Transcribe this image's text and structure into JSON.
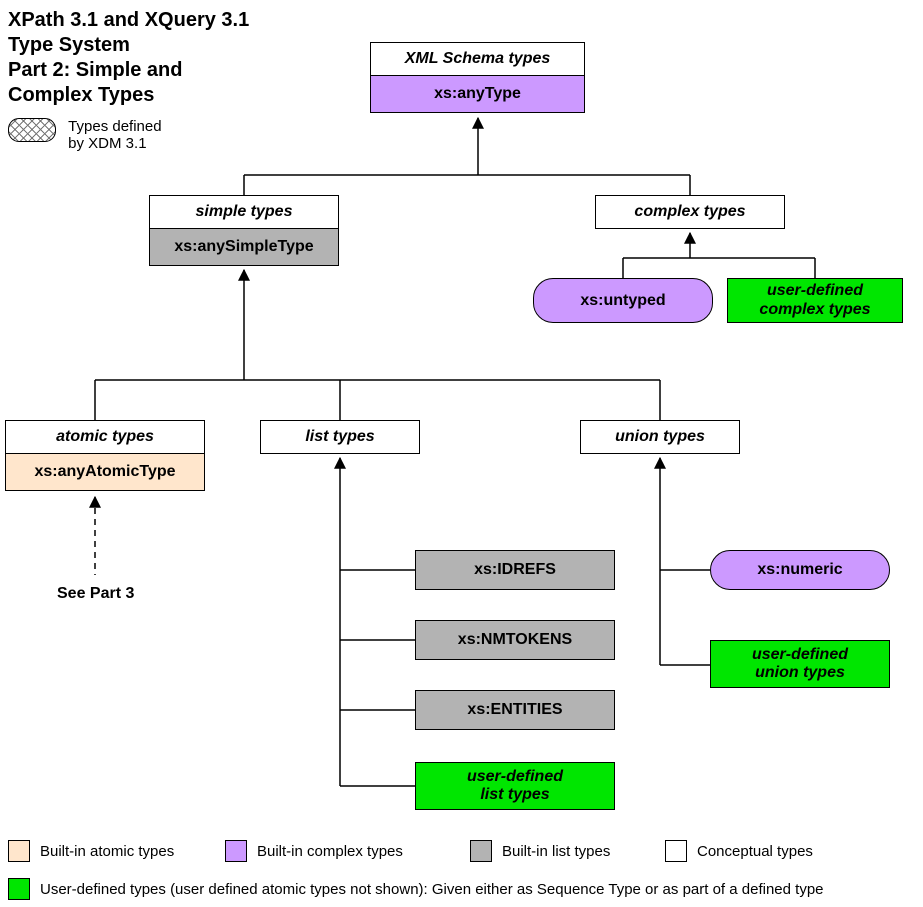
{
  "title_line1": "XPath 3.1 and XQuery 3.1",
  "title_line2": "Type System",
  "title_line3": "Part 2: Simple and",
  "title_line4": "Complex Types",
  "xdm_legend_l1": "Types defined",
  "xdm_legend_l2": "by XDM 3.1",
  "root": {
    "hdr": "XML Schema types",
    "cell": "xs:anyType"
  },
  "simple": {
    "hdr": "simple types",
    "cell": "xs:anySimpleType"
  },
  "complex": {
    "hdr": "complex types"
  },
  "untyped": "xs:untyped",
  "ud_complex": "user-defined\ncomplex types",
  "atomic": {
    "hdr": "atomic types",
    "cell": "xs:anyAtomicType"
  },
  "list": {
    "hdr": "list types"
  },
  "union": {
    "hdr": "union types"
  },
  "see_part3": "See Part 3",
  "idrefs": "xs:IDREFS",
  "nmtokens": "xs:NMTOKENS",
  "entities": "xs:ENTITIES",
  "ud_list": "user-defined\nlist types",
  "numeric": "xs:numeric",
  "ud_union": "user-defined\nunion types",
  "legend": {
    "atomic": "Built-in atomic types",
    "complex": "Built-in complex types",
    "list": "Built-in list types",
    "conceptual": "Conceptual types",
    "user": "User-defined types (user defined atomic types not shown):  Given either as Sequence Type or as part of a defined type"
  },
  "chart_data": {
    "type": "tree",
    "title": "XPath 3.1 and XQuery 3.1 Type System — Part 2: Simple and Complex Types",
    "legend_categories": {
      "built_in_atomic": "#ffe6cc",
      "built_in_complex": "#cc99ff",
      "built_in_list": "#b3b3b3",
      "conceptual": "#ffffff",
      "user_defined": "#00e600",
      "xdm_defined": "crosshatch"
    },
    "nodes": [
      {
        "id": "anyType",
        "label": "xs:anyType",
        "group": "XML Schema types",
        "category": "built_in_complex"
      },
      {
        "id": "anySimpleType",
        "label": "xs:anySimpleType",
        "group": "simple types",
        "category": "built_in_list",
        "parent": "anyType"
      },
      {
        "id": "complex",
        "label": "complex types",
        "category": "conceptual",
        "parent": "anyType"
      },
      {
        "id": "untyped",
        "label": "xs:untyped",
        "category": "built_in_complex",
        "parent": "complex",
        "xdm_defined": true
      },
      {
        "id": "ud_complex",
        "label": "user-defined complex types",
        "category": "user_defined",
        "parent": "complex"
      },
      {
        "id": "atomic",
        "label": "atomic types",
        "category": "conceptual",
        "parent": "anySimpleType"
      },
      {
        "id": "anyAtomicType",
        "label": "xs:anyAtomicType",
        "category": "built_in_atomic",
        "parent": "atomic",
        "note": "See Part 3"
      },
      {
        "id": "list",
        "label": "list types",
        "category": "conceptual",
        "parent": "anySimpleType"
      },
      {
        "id": "IDREFS",
        "label": "xs:IDREFS",
        "category": "built_in_list",
        "parent": "list"
      },
      {
        "id": "NMTOKENS",
        "label": "xs:NMTOKENS",
        "category": "built_in_list",
        "parent": "list"
      },
      {
        "id": "ENTITIES",
        "label": "xs:ENTITIES",
        "category": "built_in_list",
        "parent": "list"
      },
      {
        "id": "ud_list",
        "label": "user-defined list types",
        "category": "user_defined",
        "parent": "list"
      },
      {
        "id": "union",
        "label": "union types",
        "category": "conceptual",
        "parent": "anySimpleType"
      },
      {
        "id": "numeric",
        "label": "xs:numeric",
        "category": "built_in_complex",
        "parent": "union",
        "xdm_defined": true
      },
      {
        "id": "ud_union",
        "label": "user-defined union types",
        "category": "user_defined",
        "parent": "union"
      }
    ]
  }
}
